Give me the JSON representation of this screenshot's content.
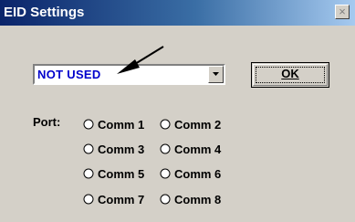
{
  "window": {
    "title": "EID Settings",
    "close_glyph": "×"
  },
  "selector": {
    "value": "NOT USED"
  },
  "ok_button": {
    "label": "OK"
  },
  "port": {
    "label": "Port:",
    "options": [
      "Comm 1",
      "Comm 2",
      "Comm 3",
      "Comm 4",
      "Comm 5",
      "Comm 6",
      "Comm 7",
      "Comm 8"
    ]
  },
  "colors": {
    "title_gradient_start": "#0a246a",
    "title_gradient_end": "#a6caf0",
    "dialog_background": "#d4d0c8",
    "select_text": "#0000cc"
  }
}
